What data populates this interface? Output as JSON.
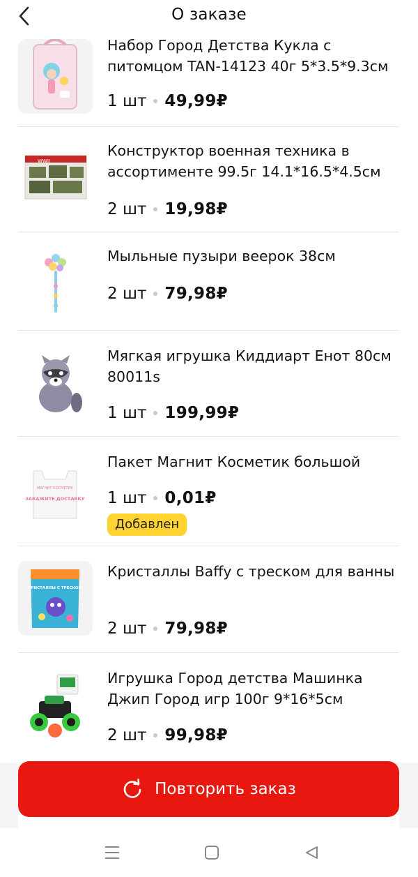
{
  "header": {
    "title": "О заказе",
    "back_icon": "chevron-left-icon"
  },
  "items": [
    {
      "name": "Набор Город Детства Кукла с питомцом TAN-14123 40г 5*3.5*9.3см",
      "qty": "1 шт",
      "price": "49,99₽",
      "image": "doll-set-image"
    },
    {
      "name": "Конструктор военная техника в ассортименте 99.5г 14.1*16.5*4.5см",
      "qty": "2 шт",
      "price": "19,98₽",
      "image": "military-construction-set-image"
    },
    {
      "name": "Мыльные пузыри веерок 38см",
      "qty": "2 шт",
      "price": "79,98₽",
      "image": "soap-bubbles-wand-image"
    },
    {
      "name": "Мягкая игрушка Киддиарт Енот 80см 80011s",
      "qty": "1 шт",
      "price": "199,99₽",
      "image": "raccoon-plush-image"
    },
    {
      "name": "Пакет Магнит Косметик большой",
      "qty": "1 шт",
      "price": "0,01₽",
      "badge": "Добавлен",
      "image": "shopping-bag-image",
      "bag_text_top": "МАГНИТ КОСМЕТИК",
      "bag_text_main": "ЗАКАЖИТЕ ДОСТАВКУ"
    },
    {
      "name": "Кристаллы Baffy с треском для ванны",
      "qty": "2 шт",
      "price": "79,98₽",
      "image": "bath-crystals-pack-image",
      "pack_text": "КРИСТАЛЛЫ С ТРЕСКОМ"
    },
    {
      "name": "Игрушка Город детства Машинка Джип Город игр 100г 9*16*5см",
      "qty": "2 шт",
      "price": "99,98₽",
      "image": "toy-jeep-image"
    }
  ],
  "footer": {
    "repeat_button_label": "Повторить заказ",
    "repeat_icon": "refresh-icon"
  },
  "system_nav": {
    "menu_icon": "menu-icon",
    "home_icon": "home-square-icon",
    "back_icon": "back-triangle-icon"
  },
  "colors": {
    "accent_red": "#e8170f",
    "badge_yellow": "#ffd330",
    "divider": "#e4e4e4"
  }
}
